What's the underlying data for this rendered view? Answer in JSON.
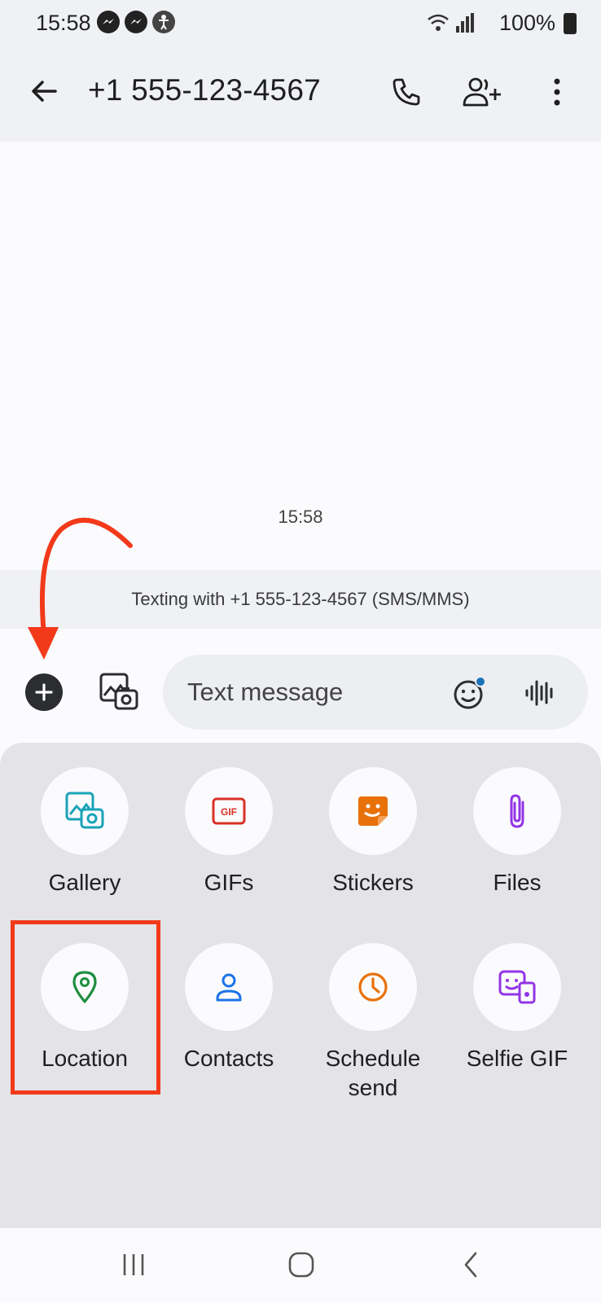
{
  "status_bar": {
    "time": "15:58",
    "battery": "100%",
    "icons": [
      "messenger-icon",
      "messenger-icon",
      "accessibility-icon",
      "wifi-icon",
      "signal-icon",
      "battery-icon"
    ]
  },
  "app_bar": {
    "title": "+1 555-123-4567",
    "icons": [
      "back-arrow-icon",
      "phone-icon",
      "add-person-icon",
      "more-vertical-icon"
    ]
  },
  "conversation": {
    "timestamp": "15:58",
    "texting_banner": "Texting with +1 555-123-4567 (SMS/MMS)"
  },
  "compose": {
    "placeholder": "Text message",
    "icons": [
      "add-circle-icon",
      "gallery-camera-icon",
      "emoji-icon",
      "voice-icon"
    ]
  },
  "attach_panel": {
    "items": [
      {
        "label": "Gallery",
        "icon": "gallery-icon",
        "color": "#1aa3b8"
      },
      {
        "label": "GIFs",
        "icon": "gif-icon",
        "color": "#d93025"
      },
      {
        "label": "Stickers",
        "icon": "sticker-icon",
        "color": "#e8710a"
      },
      {
        "label": "Files",
        "icon": "paperclip-icon",
        "color": "#9334e6"
      },
      {
        "label": "Location",
        "icon": "location-pin-icon",
        "color": "#1e8e3e"
      },
      {
        "label": "Contacts",
        "icon": "person-icon",
        "color": "#1a73e8"
      },
      {
        "label": "Schedule send",
        "icon": "clock-icon",
        "color": "#e8710a"
      },
      {
        "label": "Selfie GIF",
        "icon": "selfie-gif-icon",
        "color": "#9334e6"
      }
    ]
  },
  "nav_bar": {
    "icons": [
      "recents-icon",
      "home-icon",
      "back-icon"
    ]
  },
  "annotation": {
    "color": "#f23a1a"
  }
}
